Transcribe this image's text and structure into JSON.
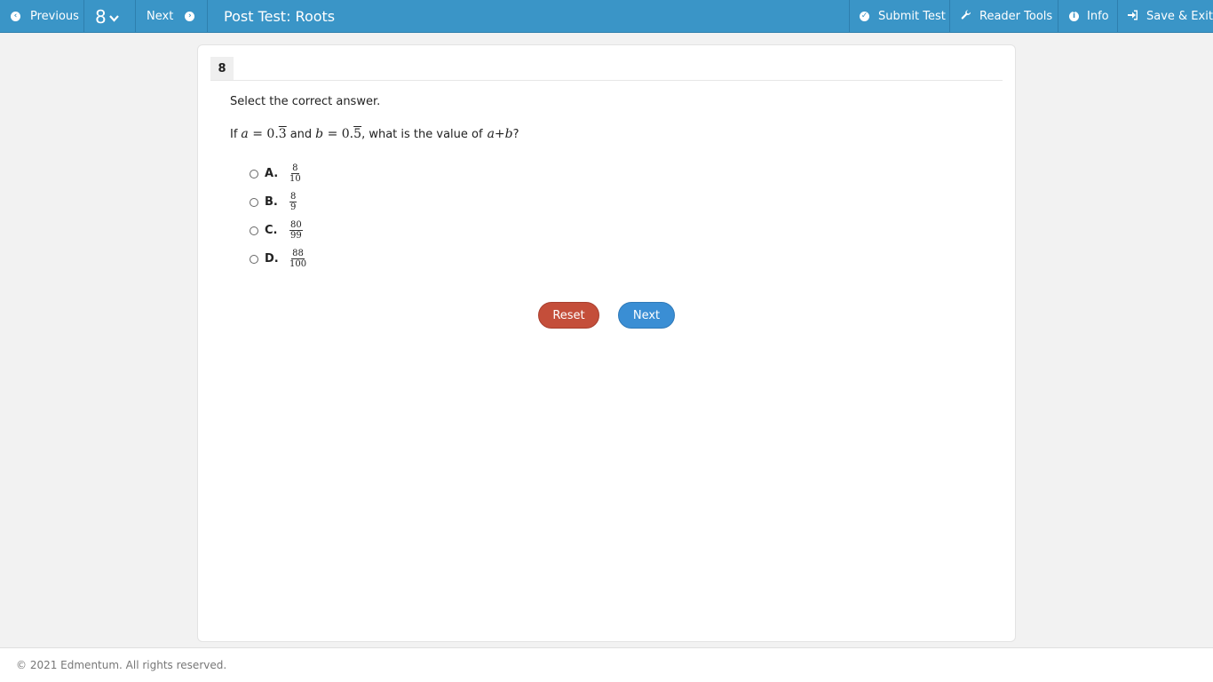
{
  "toolbar": {
    "previous_label": "Previous",
    "question_selector": "8",
    "next_label": "Next",
    "title": "Post Test: Roots",
    "submit_label": "Submit Test",
    "reader_tools_label": "Reader Tools",
    "info_label": "Info",
    "save_exit_label": "Save & Exit"
  },
  "question": {
    "number": "8",
    "instruction": "Select the correct answer.",
    "text_if": "If",
    "var_a": "a",
    "eq1": " = 0.",
    "digit_a": "3",
    "text_and": "and",
    "var_b": "b",
    "eq2": " = 0.",
    "digit_b": "5",
    "text_what": ", what is the value of",
    "sum_a": "a",
    "plus": "+",
    "sum_b": "b",
    "qmark": "?"
  },
  "options": [
    {
      "letter": "A.",
      "numerator": "8",
      "denominator": "10"
    },
    {
      "letter": "B.",
      "numerator": "8",
      "denominator": "9"
    },
    {
      "letter": "C.",
      "numerator": "80",
      "denominator": "99"
    },
    {
      "letter": "D.",
      "numerator": "88",
      "denominator": "100"
    }
  ],
  "actions": {
    "reset_label": "Reset",
    "next_label": "Next"
  },
  "colors": {
    "topbar": "#3a95c7",
    "reset": "#c44e3a",
    "next": "#3a8ed4"
  },
  "footer": {
    "copyright": "© 2021 Edmentum. All rights reserved."
  }
}
